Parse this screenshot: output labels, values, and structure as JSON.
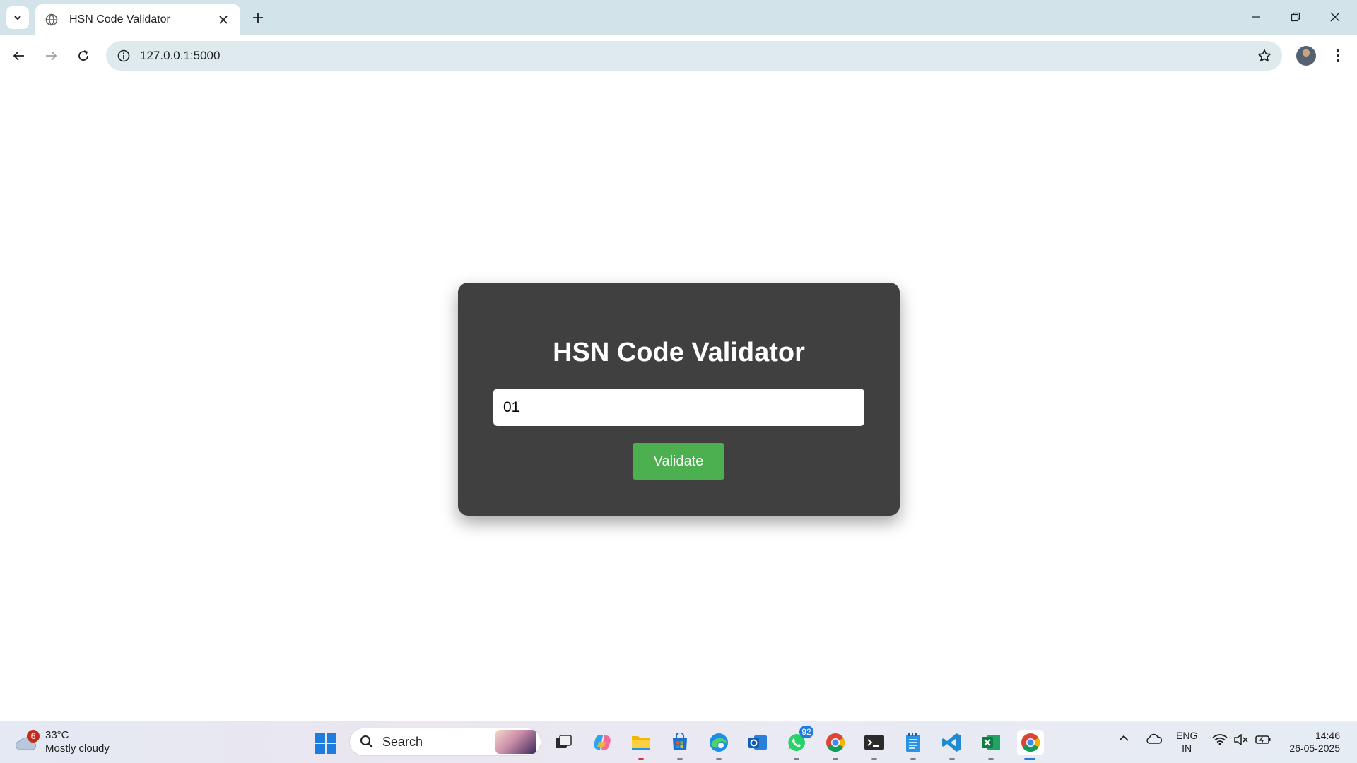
{
  "browser": {
    "tab_title": "HSN Code Validator",
    "url": "127.0.0.1:5000"
  },
  "page": {
    "title": "HSN Code Validator",
    "input_value": "01",
    "button_label": "Validate"
  },
  "taskbar": {
    "weather": {
      "badge": "6",
      "temperature": "33°C",
      "condition": "Mostly cloudy"
    },
    "search_label": "Search",
    "whatsapp_badge": "92",
    "language": {
      "line1": "ENG",
      "line2": "IN"
    },
    "clock": {
      "time": "14:46",
      "date": "26-05-2025"
    }
  },
  "colors": {
    "card_bg": "#404040",
    "button_bg": "#4caf50",
    "tabbar_bg": "#d3e3ea",
    "omnibox_bg": "#dfeaef"
  },
  "icons": {
    "tab_favicon": "globe-icon",
    "taskbar_apps": [
      "task-view-icon",
      "copilot-icon",
      "file-explorer-icon",
      "microsoft-store-icon",
      "edge-icon",
      "outlook-icon",
      "whatsapp-icon",
      "chrome-icon",
      "terminal-icon",
      "notepad-icon",
      "vscode-icon",
      "excel-icon",
      "chrome-active-icon"
    ]
  }
}
